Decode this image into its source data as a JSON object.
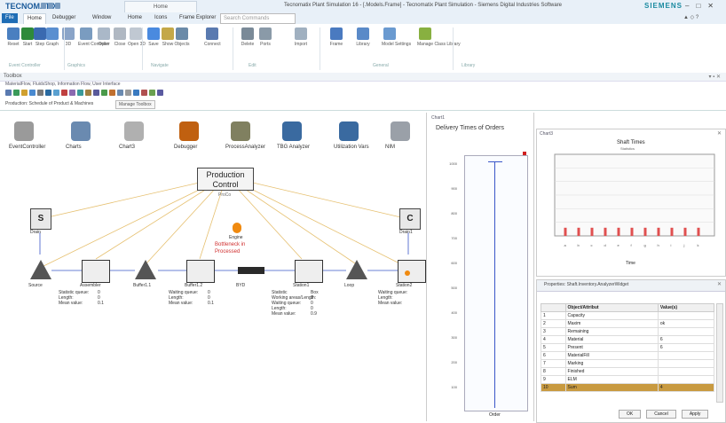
{
  "app": {
    "logo": "TECNOMATIX",
    "ctx_tab": "Home",
    "window_title": "Tecnomatix Plant Simulation 16 - [.Models.Frame] - Tecnomatix Plant Simulation - Siemens Digital Industries Software",
    "brand": "SIEMENS",
    "window_controls": [
      "–",
      "□",
      "✕"
    ]
  },
  "tabs": [
    "File",
    "Home",
    "Debugger",
    "Window",
    "Home",
    "Icons",
    "Frame Explorer"
  ],
  "tab_active_index": 1,
  "search_placeholder": "Search Commands",
  "ribbon": {
    "buttons": [
      {
        "label": "Reset",
        "color": "#4a7fc0"
      },
      {
        "label": "Start",
        "color": "#2e8a3a"
      },
      {
        "label": "Step",
        "color": "#3a6ab0"
      },
      {
        "label": "Graph",
        "color": "#5a8fd0"
      },
      {
        "label": "3D",
        "color": "#8aa4c8"
      },
      {
        "label": "Event Controller",
        "color": "#7a9cc0"
      },
      {
        "label": "Open",
        "color": "#aab8c8"
      },
      {
        "label": "Close",
        "color": "#b0b8c2"
      },
      {
        "label": "Open 3D",
        "color": "#c0c8d2"
      },
      {
        "label": "Save",
        "color": "#4a8adf"
      },
      {
        "label": "Show",
        "color": "#c4a848"
      },
      {
        "label": "Objects",
        "color": "#6a8aa8"
      },
      {
        "label": "Connect",
        "color": "#5a7ab0"
      },
      {
        "label": "Delete",
        "color": "#7a8a98"
      },
      {
        "label": "Ports",
        "color": "#8a9aa8"
      },
      {
        "label": "Import",
        "color": "#a0b0c0"
      },
      {
        "label": "Frame",
        "color": "#4a7ac0"
      },
      {
        "label": "Library",
        "color": "#5a8ac8"
      },
      {
        "label": "Model Settings",
        "color": "#6a9ad0"
      },
      {
        "label": "Manage Class Library",
        "color": "#88b040"
      }
    ],
    "groups": [
      "Event Controller",
      "Graphics",
      "Navigate",
      "Edit",
      "General",
      "Library"
    ]
  },
  "toolbox": {
    "title": "Toolbox",
    "path": "MaterialFlow, FluidsShop, Information Flow, User Interface",
    "tab_label": "Production: Schedule of Product & Machines",
    "tab_button": "Manage Toolbox"
  },
  "frame": {
    "objects": [
      {
        "name": "EventController",
        "color": "#9a9a9a"
      },
      {
        "name": "Charts",
        "color": "#6a8ab0"
      },
      {
        "name": "Chart3",
        "color": "#b0b0b0"
      },
      {
        "name": "Debugger",
        "color": "#c06010"
      },
      {
        "name": "ProcessAnalyzer",
        "color": "#808060"
      },
      {
        "name": "TBG Analyzer",
        "color": "#3a6aa0"
      },
      {
        "name": "Utilization Vars",
        "color": "#3a6aa0"
      },
      {
        "name": "NIM",
        "color": "#9aa0a8"
      }
    ],
    "production_control": "Production Control",
    "production_sub": "ProCo",
    "bottleneck_label": "Engine",
    "notes": [
      "Bottleneck in",
      "Processed"
    ],
    "source": "S",
    "sink": "C",
    "source_label": "Drain",
    "sink_label": "Drain1",
    "flow": [
      "Source",
      "Assembler",
      "Buffer1.1",
      "Buffer1.2",
      "BYD",
      "Station1",
      "Loop",
      "Station2",
      "Sorting"
    ],
    "stats1": [
      "Statistic queue:",
      "Length:",
      "Mean value:"
    ],
    "stats1_vals": [
      "0",
      "0",
      "0.1"
    ],
    "stats2": [
      "Waiting queue:",
      "Length:",
      "Mean value:"
    ],
    "stats2_vals": [
      "0",
      "0",
      "0.1"
    ],
    "stats3": [
      "Statistic",
      "Working areas/Length:",
      "Waiting queue:",
      "Length:",
      "Mean value:"
    ],
    "stats3_vals": [
      "Box",
      "0",
      "0",
      "0",
      "0.9"
    ],
    "stats4": [
      "Waiting queue:",
      "Length:",
      "Mean value:"
    ],
    "stats4_vals": [
      "",
      "",
      ""
    ]
  },
  "chart_delivery": {
    "header": "Chart1",
    "title": "Delivery Times of Orders",
    "yticks": [
      "1000",
      "900",
      "800",
      "700",
      "600",
      "500",
      "400",
      "300",
      "200",
      "100"
    ],
    "x_label": "Order"
  },
  "chart_data": {
    "type": "bar",
    "title": "Shaft Times",
    "subtitle": "Statistics",
    "header": "Chart3",
    "categories": [
      "a",
      "b",
      "c",
      "d",
      "e",
      "f",
      "g",
      "h",
      "i",
      "j",
      "k"
    ],
    "values": [
      1,
      1,
      1,
      1,
      1,
      1,
      1,
      1,
      1,
      1,
      1
    ],
    "ylim": [
      0,
      10
    ],
    "xlabel": "Time"
  },
  "attribute_table": {
    "title": "Properties: Shaft.Inventory.AnalyzerWidget",
    "headers": [
      "",
      "Object/Attribut",
      "Value(s)"
    ],
    "rows": [
      [
        "1",
        "Capacity",
        ""
      ],
      [
        "2",
        "Maxim",
        "ok"
      ],
      [
        "3",
        "Remaining",
        ""
      ],
      [
        "4",
        "Material",
        "6"
      ],
      [
        "5",
        "Present",
        "6"
      ],
      [
        "6",
        "MaterialFill",
        ""
      ],
      [
        "7",
        "Marking",
        ""
      ],
      [
        "8",
        "Finished",
        ""
      ],
      [
        "9",
        "ELM",
        ""
      ],
      [
        "10",
        "Sum",
        "4"
      ]
    ],
    "selected_row": 9,
    "buttons": [
      "OK",
      "Cancel",
      "Apply"
    ]
  }
}
